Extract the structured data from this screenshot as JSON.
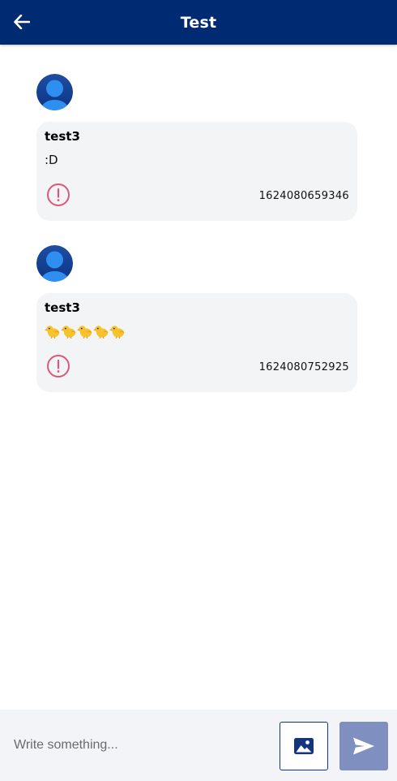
{
  "header": {
    "title": "Test",
    "back_icon": "arrow-left-icon",
    "background": "#002a72"
  },
  "messages": [
    {
      "sender": "test3",
      "text": ":D",
      "timestamp": "1624080659346",
      "status_icon": "error-exclamation-icon",
      "avatar_icon": "user-avatar-icon"
    },
    {
      "sender": "test3",
      "text": "🐤🐤🐤🐤🐤",
      "timestamp": "1624080752925",
      "status_icon": "error-exclamation-icon",
      "avatar_icon": "user-avatar-icon"
    }
  ],
  "composer": {
    "placeholder": "Write something...",
    "value": "",
    "image_button_icon": "image-icon",
    "send_button_icon": "send-icon",
    "accent": "#12357e",
    "send_color": "#7e8fc0"
  }
}
